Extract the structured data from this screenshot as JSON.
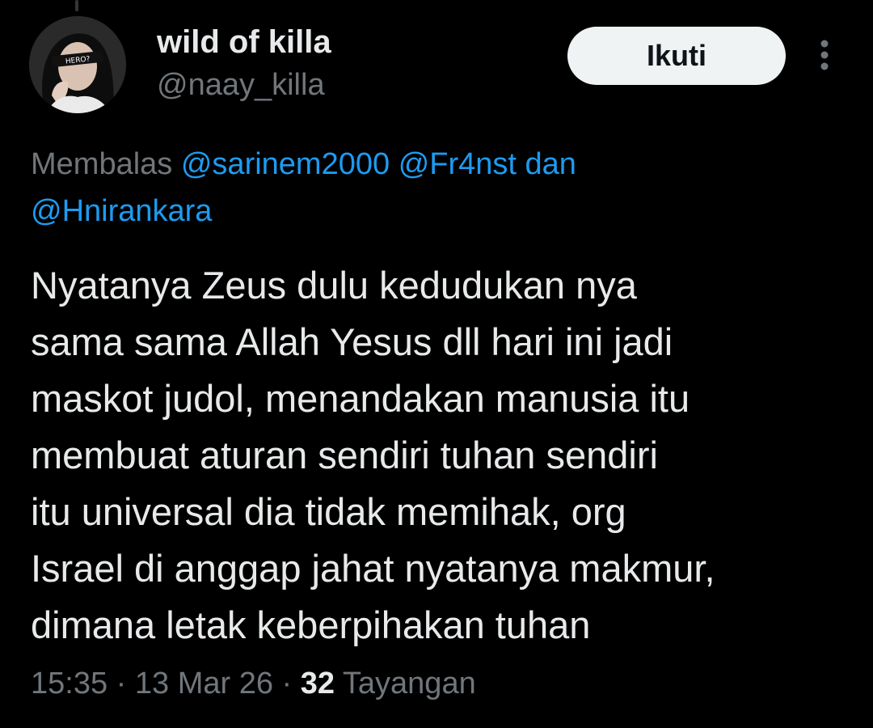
{
  "author": {
    "display_name": "wild of killa",
    "handle": "@naay_killa",
    "avatar_icon": "profile-photo",
    "avatar_badge_text": "HERO?"
  },
  "actions": {
    "follow_label": "Ikuti",
    "more_icon": "more-vertical-icon"
  },
  "reply_context": {
    "prefix": "Membalas",
    "mentions": [
      "@sarinem2000",
      "@Fr4nst"
    ],
    "conjunction": "dan",
    "last_mention": "@Hnirankara"
  },
  "tweet": {
    "text": "Nyatanya Zeus dulu kedudukan nya\nsama sama Allah Yesus dll hari ini jadi\nmaskot judol, menandakan manusia itu\nmembuat aturan sendiri tuhan sendiri\nitu universal dia tidak memihak, org\nIsrael di anggap jahat nyatanya makmur,\ndimana letak keberpihakan tuhan"
  },
  "meta": {
    "time": "15:35",
    "separator": "·",
    "date": "13 Mar 26",
    "views_count": "32",
    "views_label": "Tayangan"
  },
  "colors": {
    "background": "#000000",
    "text_primary": "#e7e9ea",
    "text_secondary": "#71767b",
    "link": "#1d9bf0",
    "button_bg": "#eff3f4"
  }
}
